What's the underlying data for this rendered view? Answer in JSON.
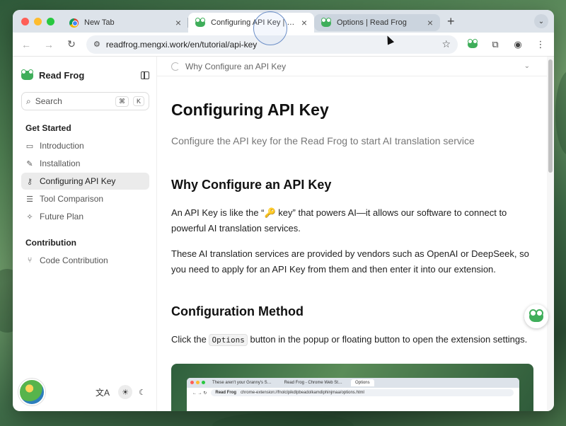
{
  "browser": {
    "tabs": [
      {
        "title": "New Tab",
        "icon": "chrome-icon",
        "state": "inactive"
      },
      {
        "title": "Configuring API Key | Read Frog",
        "icon": "frog-icon",
        "state": "active"
      },
      {
        "title": "Options | Read Frog",
        "icon": "frog-icon",
        "state": "hover"
      }
    ],
    "new_tab": "+",
    "tab_menu": "⌄",
    "url": "readfrog.mengxi.work/en/tutorial/api-key"
  },
  "sidebar": {
    "brand": "Read Frog",
    "search": {
      "label": "Search",
      "kbd1": "⌘",
      "kbd2": "K"
    },
    "sections": [
      {
        "title": "Get Started",
        "items": [
          {
            "label": "Introduction",
            "icon": "book-icon"
          },
          {
            "label": "Installation",
            "icon": "wrench-icon"
          },
          {
            "label": "Configuring API Key",
            "icon": "key-icon",
            "active": true
          },
          {
            "label": "Tool Comparison",
            "icon": "list-icon"
          },
          {
            "label": "Future Plan",
            "icon": "sparkle-icon"
          }
        ]
      },
      {
        "title": "Contribution",
        "items": [
          {
            "label": "Code Contribution",
            "icon": "git-branch-icon"
          }
        ]
      }
    ]
  },
  "toc": {
    "label": "Why Configure an API Key"
  },
  "article": {
    "title": "Configuring API Key",
    "subtitle": "Configure the API key for the Read Frog to start AI translation service",
    "h2_1": "Why Configure an API Key",
    "p1": "An API Key is like the “🔑 key” that powers AI—it allows our software to connect to powerful AI translation services.",
    "p2": "These AI translation services are provided by vendors such as OpenAI or DeepSeek, so you need to apply for an API Key from them and then enter it into our extension.",
    "h2_2": "Configuration Method",
    "p3_before": "Click the",
    "p3_code": "Options",
    "p3_after": "button in the popup or floating button to open the extension settings.",
    "screenshot": {
      "tab1": "These aren't your Granny's S…",
      "tab2": "Read Frog - Chrome Web St…",
      "tab3": "Options",
      "brand": "Read Frog",
      "url": "chrome-extension://fnolclpikdlpbeadolkamdiphinjmaa/options.html"
    }
  },
  "colors": {
    "accent_green": "#3fae5a",
    "active_bg": "#ebebeb"
  }
}
